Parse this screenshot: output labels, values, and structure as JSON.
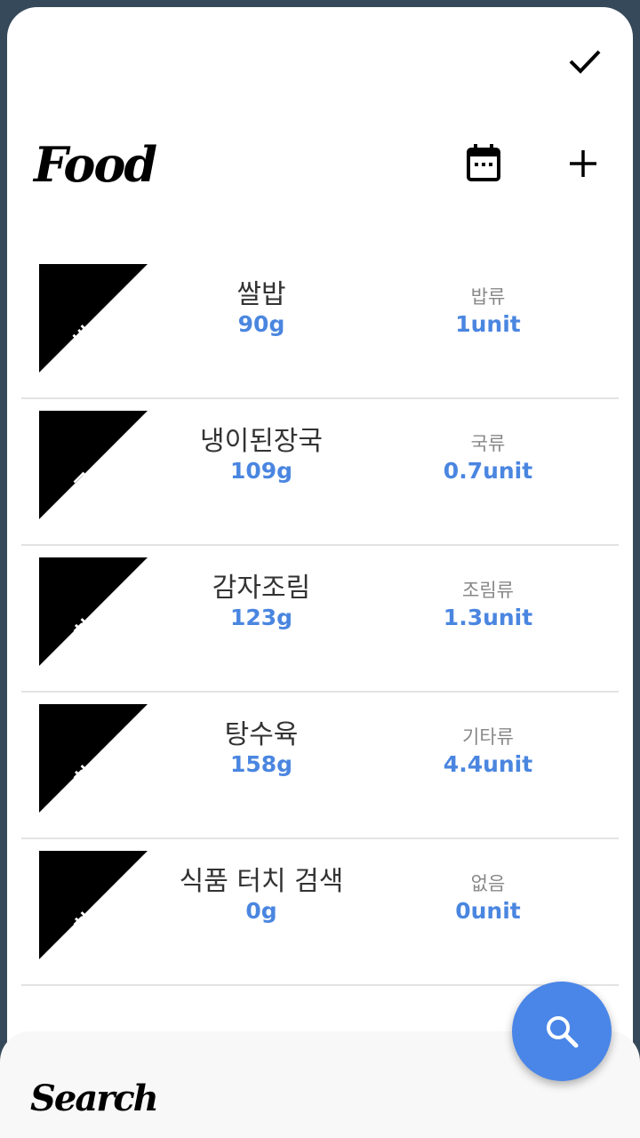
{
  "header": {
    "title": "Food",
    "confirm_icon": "check-icon",
    "calendar_icon": "calendar-icon",
    "add_icon": "plus-icon"
  },
  "foods": [
    {
      "tag": "밥",
      "name": "쌀밥",
      "weight": "90g",
      "category": "밥류",
      "units": "1unit"
    },
    {
      "tag": "국",
      "name": "냉이된장국",
      "weight": "109g",
      "category": "국류",
      "units": "0.7unit"
    },
    {
      "tag": "찬",
      "name": "감자조림",
      "weight": "123g",
      "category": "조림류",
      "units": "1.3unit"
    },
    {
      "tag": "찬",
      "name": "탕수육",
      "weight": "158g",
      "category": "기타류",
      "units": "4.4unit"
    },
    {
      "tag": "찬",
      "name": "식품 터치 검색",
      "weight": "0g",
      "category": "없음",
      "units": "0unit"
    }
  ],
  "bottom_sheet": {
    "title": "Search"
  },
  "fab": {
    "icon": "search-icon"
  },
  "colors": {
    "accent": "#4a86e8",
    "background": "#36495a",
    "tag": "#000000"
  }
}
